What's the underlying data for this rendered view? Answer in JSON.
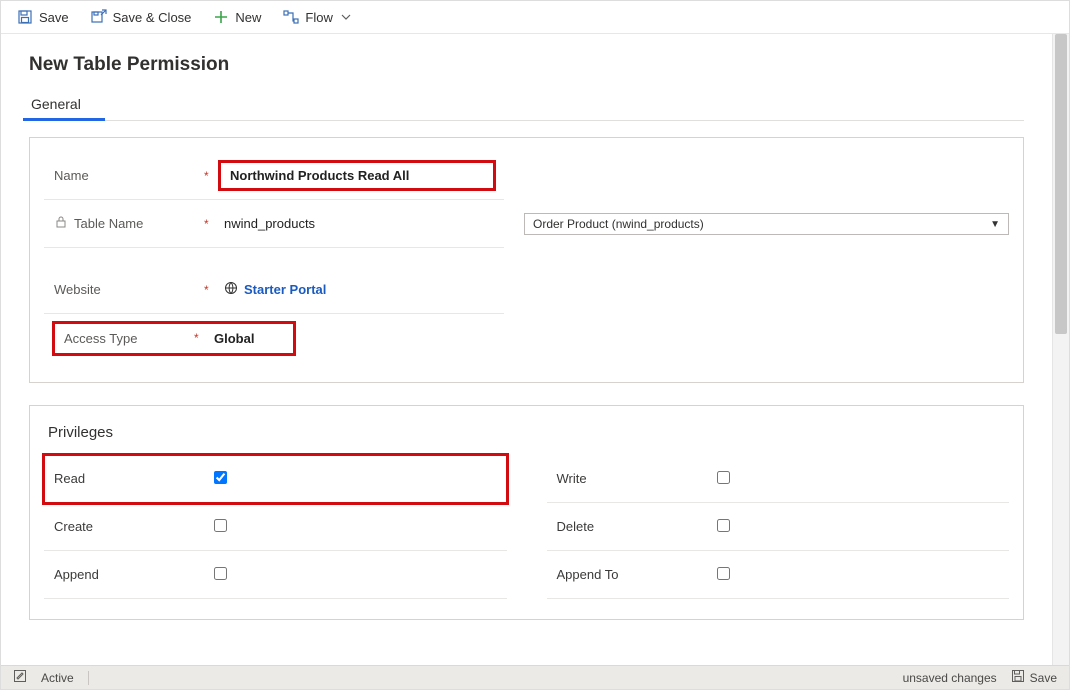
{
  "toolbar": {
    "save": "Save",
    "save_close": "Save & Close",
    "new": "New",
    "flow": "Flow"
  },
  "page": {
    "title": "New Table Permission",
    "tab_general": "General"
  },
  "form": {
    "name_label": "Name",
    "name_value": "Northwind Products Read All",
    "table_name_label": "Table Name",
    "table_name_value": "nwind_products",
    "table_select_value": "Order Product (nwind_products)",
    "website_label": "Website",
    "website_value": "Starter Portal",
    "access_type_label": "Access Type",
    "access_type_value": "Global",
    "required_mark": "*"
  },
  "privileges": {
    "section_title": "Privileges",
    "read": "Read",
    "write": "Write",
    "create": "Create",
    "delete": "Delete",
    "append": "Append",
    "append_to": "Append To"
  },
  "status": {
    "state": "Active",
    "unsaved": "unsaved changes",
    "save": "Save"
  }
}
